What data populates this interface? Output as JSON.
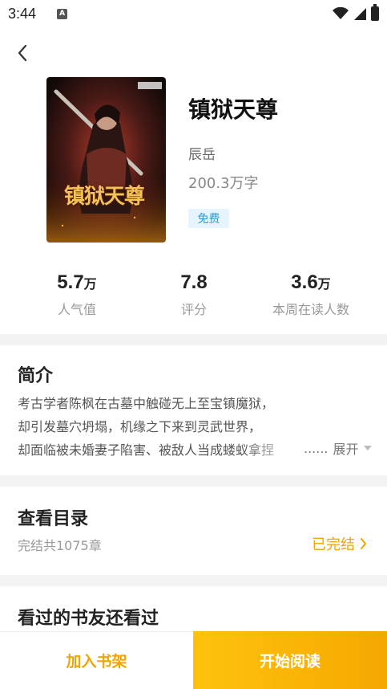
{
  "status_bar": {
    "time": "3:44",
    "notification_letter": "A"
  },
  "book": {
    "title": "镇狱天尊",
    "author": "辰岳",
    "word_count": "200.3万字",
    "badge": "免费",
    "cover_title_text": "镇狱天尊"
  },
  "stats": [
    {
      "value": "5.7",
      "unit": "万",
      "label": "人气值"
    },
    {
      "value": "7.8",
      "unit": "",
      "label": "评分"
    },
    {
      "value": "3.6",
      "unit": "万",
      "label": "本周在读人数"
    }
  ],
  "intro": {
    "heading": "简介",
    "lines": [
      "考古学者陈枫在古墓中触碰无上至宝镇魔狱，",
      "却引发墓穴坍塌，机缘之下来到灵武世界，",
      "却面临被未婚妻子陷害、被敌人当成蝼蚁拿捏"
    ],
    "ellipsis": "......",
    "expand_label": "展开"
  },
  "catalog": {
    "heading": "查看目录",
    "chapter_count": "完结共1075章",
    "status": "已完结"
  },
  "recommend": {
    "heading": "看过的书友还看过"
  },
  "actions": {
    "add_shelf": "加入书架",
    "start_reading": "开始阅读"
  },
  "colors": {
    "accent": "#f0a500",
    "badge_bg": "#e6f5fd",
    "badge_text": "#2d9bd6"
  }
}
